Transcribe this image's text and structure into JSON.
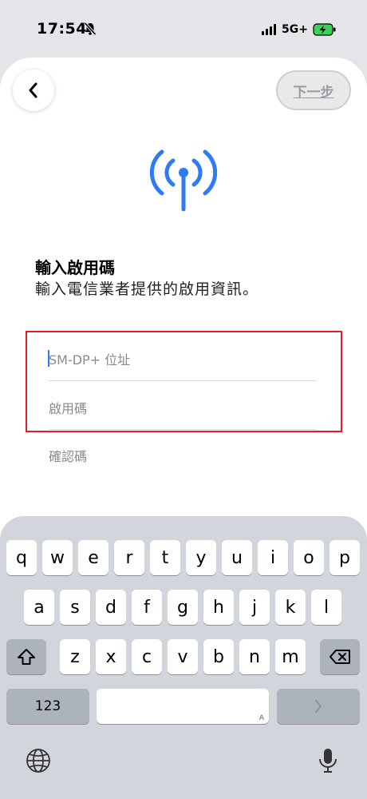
{
  "status_bar": {
    "time": "17:54",
    "network": "5G+",
    "icons": [
      "bell-slash-icon",
      "signal-icon",
      "battery-charging-icon"
    ]
  },
  "nav": {
    "back_icon": "chevron-left-icon",
    "next_label": "下一步"
  },
  "header": {
    "icon": "antenna-icon",
    "title": "輸入啟用碼",
    "subtitle": "輸入電信業者提供的啟用資訊。"
  },
  "form": {
    "fields": [
      {
        "placeholder": "SM-DP+ 位址"
      },
      {
        "placeholder": "啟用碼"
      },
      {
        "placeholder": "確認碼"
      }
    ]
  },
  "keyboard": {
    "row1": [
      "q",
      "w",
      "e",
      "r",
      "t",
      "y",
      "u",
      "i",
      "o",
      "p"
    ],
    "row2": [
      "a",
      "s",
      "d",
      "f",
      "g",
      "h",
      "j",
      "k",
      "l"
    ],
    "row3": [
      "z",
      "x",
      "c",
      "v",
      "b",
      "n",
      "m"
    ],
    "numbers_label": "123",
    "space_hint": "A",
    "colors": {
      "background": "#d3d5dc",
      "key": "#ffffff",
      "function_key": "#adb3bc"
    }
  },
  "colors": {
    "accent": "#2f7bf5",
    "highlight_box": "#e51c23"
  }
}
